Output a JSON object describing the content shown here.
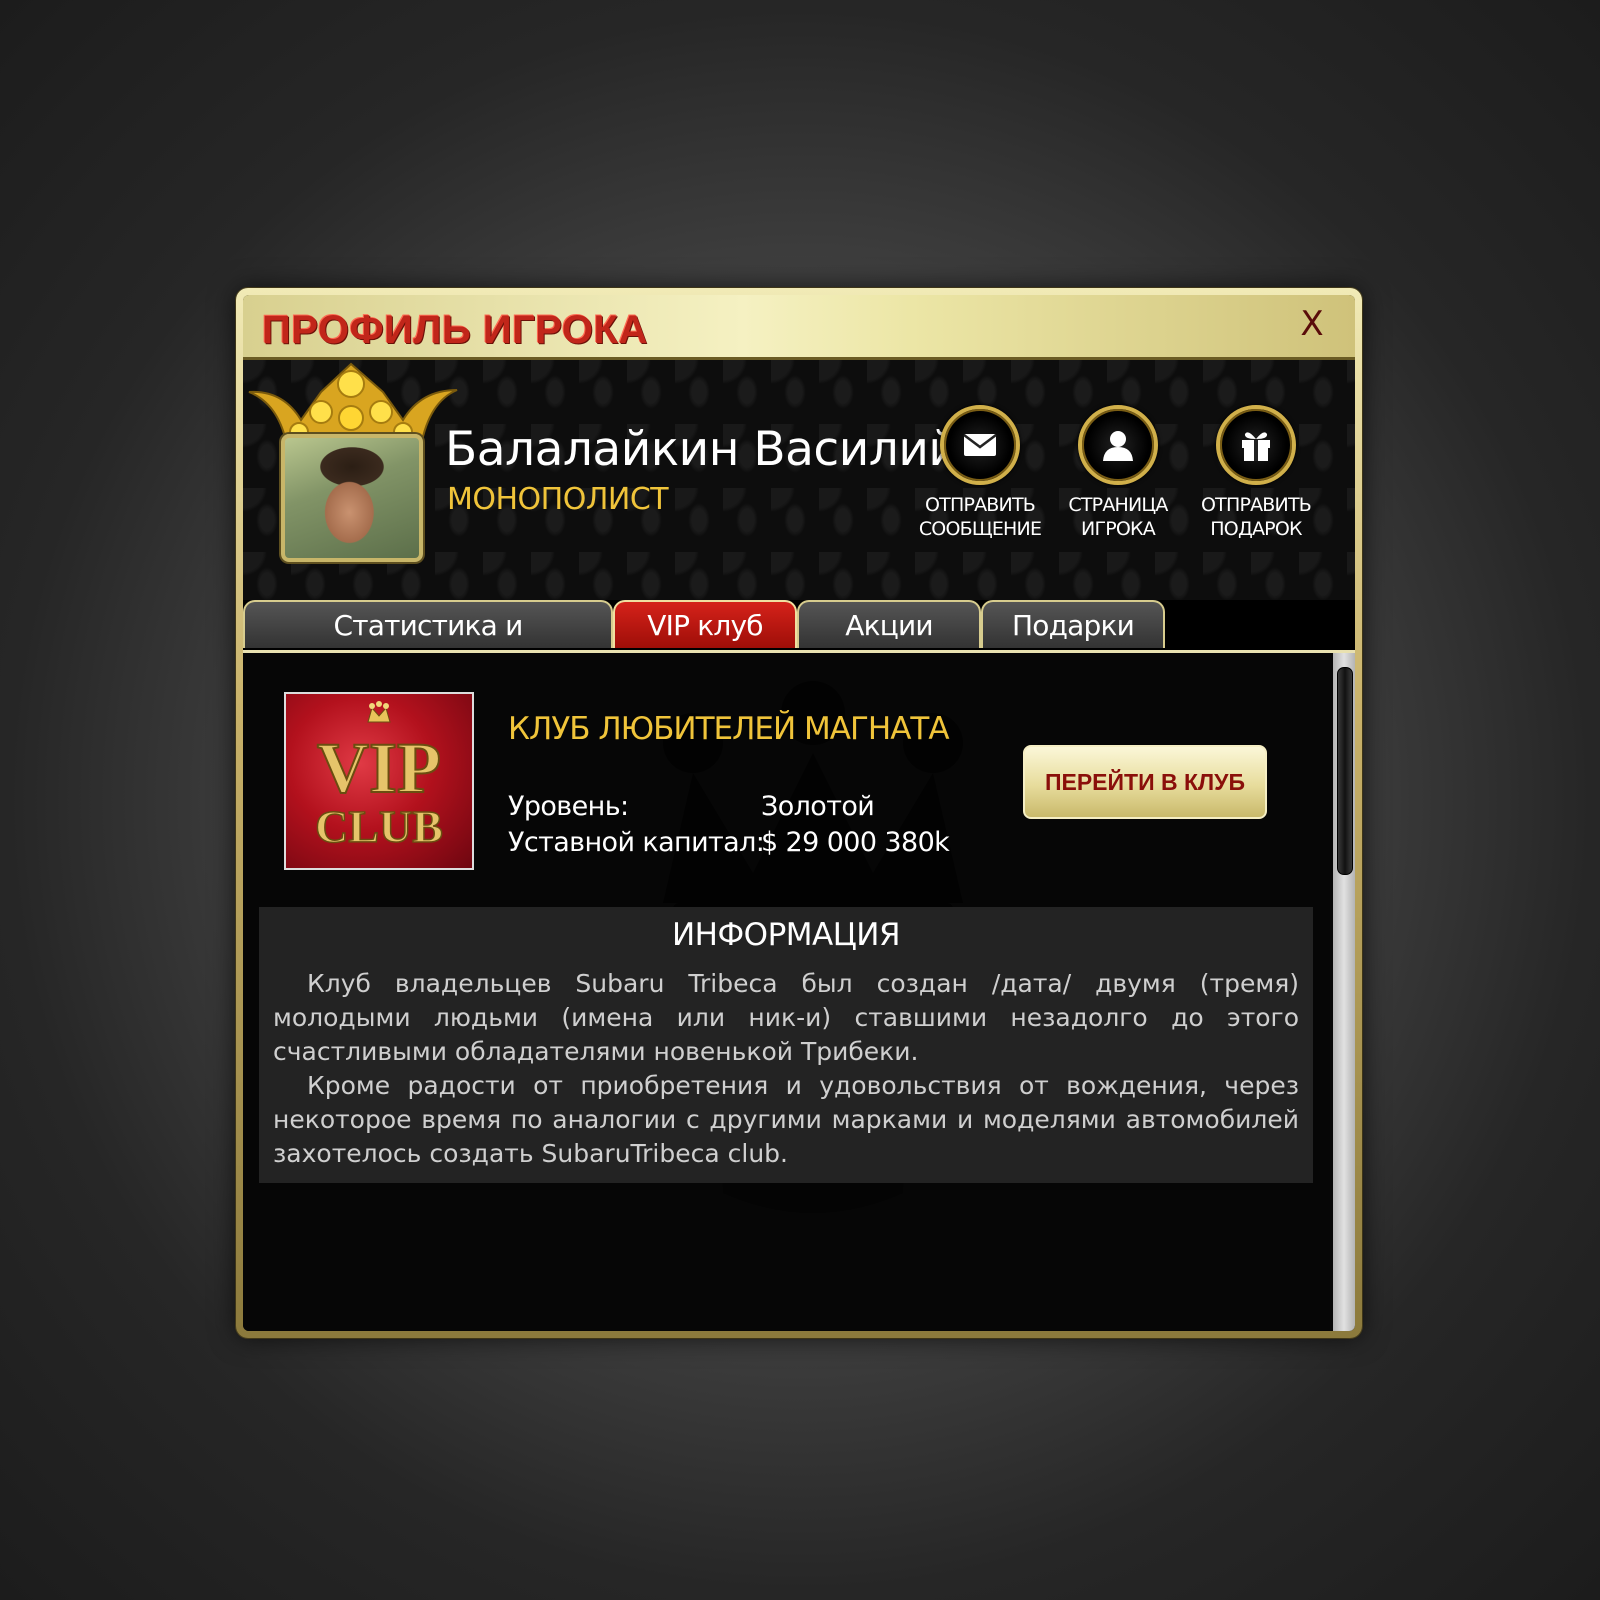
{
  "window": {
    "title": "ПРОФИЛЬ ИГРОКА",
    "close_label": "X"
  },
  "profile": {
    "name": "Балалайкин Василий",
    "rank": "МОНОПОЛИСТ",
    "actions": [
      {
        "icon": "envelope-icon",
        "line1": "ОТПРАВИТЬ",
        "line2": "СООБЩЕНИЕ"
      },
      {
        "icon": "user-icon",
        "line1": "СТРАНИЦА",
        "line2": "ИГРОКА"
      },
      {
        "icon": "gift-icon",
        "line1": "ОТПРАВИТЬ",
        "line2": "ПОДАРОК"
      }
    ]
  },
  "tabs": [
    {
      "label": "Статистика и Достижения",
      "active": false
    },
    {
      "label": "VIP клуб",
      "active": true
    },
    {
      "label": "Акции",
      "active": false
    },
    {
      "label": "Подарки",
      "active": false
    }
  ],
  "club": {
    "logo_text_top": "VIP",
    "logo_text_bottom": "CLUB",
    "title": "КЛУБ ЛЮБИТЕЛЕЙ МАГНАТА",
    "level_label": "Уровень:",
    "level_value": "Золотой",
    "capital_label": "Уставной капитал:",
    "capital_value": "$ 29 000 380k",
    "go_button": "ПЕРЕЙТИ В КЛУБ"
  },
  "info": {
    "title": "ИНФОРМАЦИЯ",
    "paragraph1": "Клуб владельцев Subaru Tribeca был создан /дата/ двумя (тремя) молодыми людьми (имена или ник-и) ставшими незадолго до этого счастливыми обладателями новенькой Трибеки.",
    "paragraph2": "Кроме радости от приобретения и удовольствия от вождения, через некоторое время по аналогии с другими марками и моделями автомобилей захотелось создать SubaruTribeca club."
  },
  "colors": {
    "accent_gold": "#f0c43a",
    "title_red": "#c1261a",
    "active_tab_red": "#c8160e"
  }
}
